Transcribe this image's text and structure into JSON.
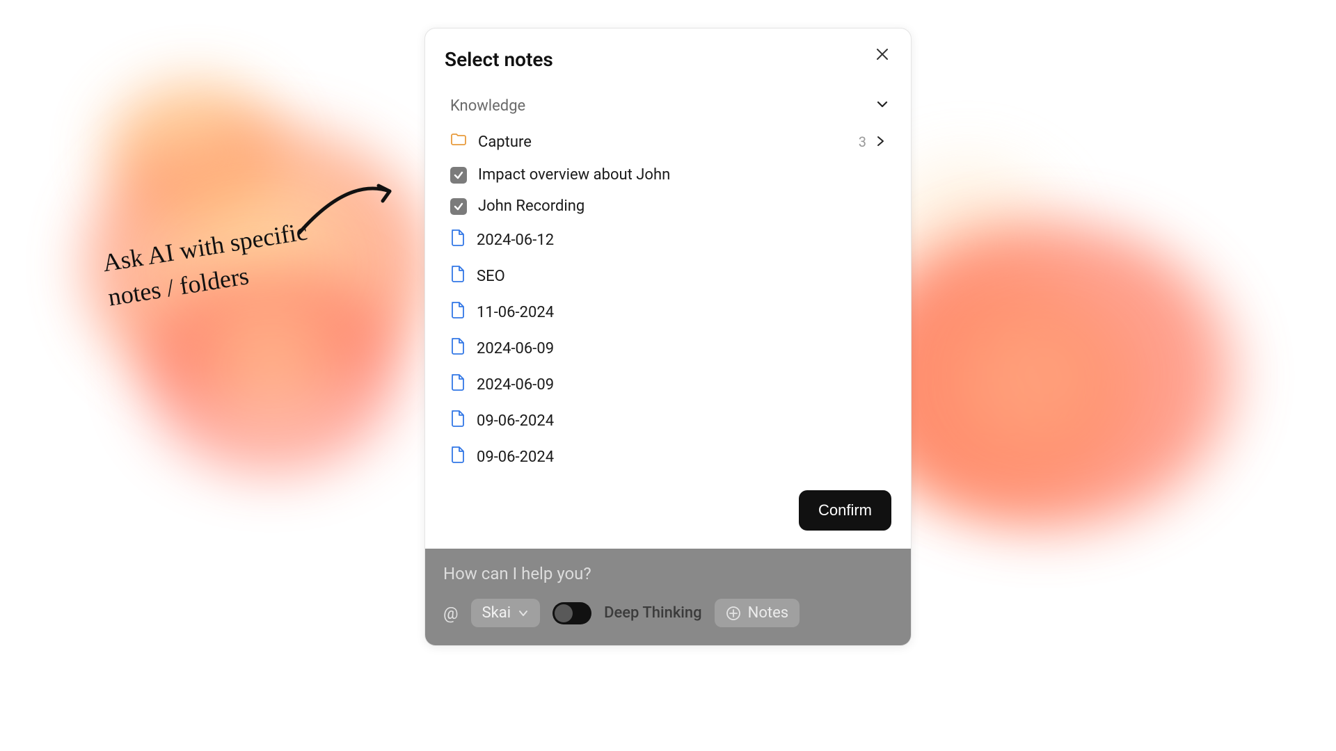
{
  "annotation": {
    "line1": "Ask AI with specific",
    "line2": "notes / folders"
  },
  "modal": {
    "title": "Select notes",
    "section_label": "Knowledge",
    "confirm_label": "Confirm",
    "items": [
      {
        "type": "folder",
        "label": "Capture",
        "count": "3"
      },
      {
        "type": "checked",
        "label": "Impact overview about John"
      },
      {
        "type": "checked",
        "label": "John Recording"
      },
      {
        "type": "file",
        "label": "2024-06-12"
      },
      {
        "type": "file",
        "label": "SEO"
      },
      {
        "type": "file",
        "label": "11-06-2024"
      },
      {
        "type": "file",
        "label": "2024-06-09"
      },
      {
        "type": "file",
        "label": "2024-06-09"
      },
      {
        "type": "file",
        "label": "09-06-2024"
      },
      {
        "type": "file",
        "label": "09-06-2024"
      }
    ]
  },
  "prompt": {
    "placeholder": "How can I help you?",
    "at": "@",
    "model": "Skai",
    "toggle_label": "Deep Thinking",
    "notes_label": "Notes"
  },
  "colors": {
    "folder": "#e89b3c",
    "file": "#3277e6",
    "check": "#7b7b7b"
  }
}
